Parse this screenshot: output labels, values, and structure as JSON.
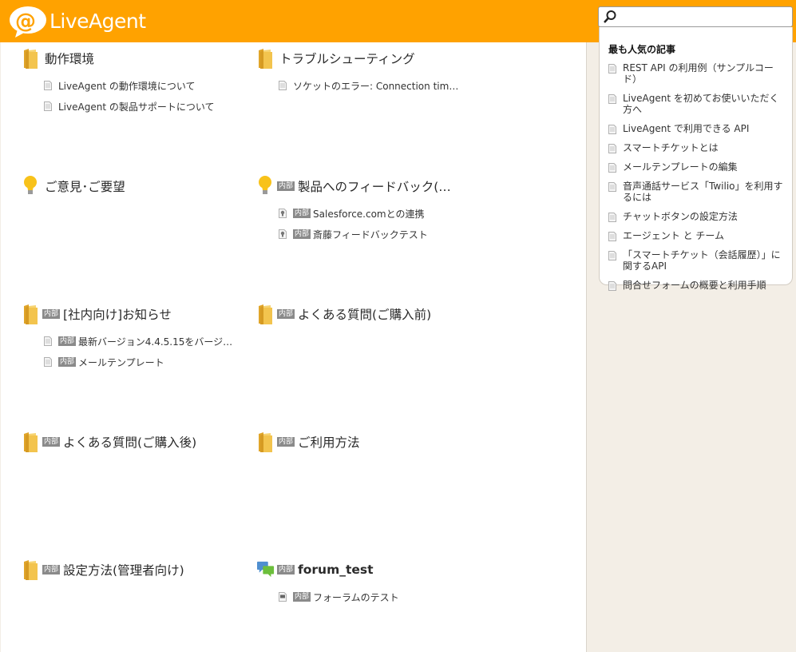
{
  "header": {
    "brand": "LiveAgent",
    "search": {
      "value": "",
      "placeholder": ""
    }
  },
  "badge_label": "内部",
  "categories": [
    {
      "title": "動作環境",
      "icon": "folder-icon",
      "internal": false,
      "bold": false,
      "articles": [
        {
          "text": "LiveAgent の動作環境について",
          "internal": false,
          "icon": "document-icon"
        },
        {
          "text": "LiveAgent の製品サポートについて",
          "internal": false,
          "icon": "document-icon"
        }
      ]
    },
    {
      "title": "トラブルシューティング",
      "icon": "folder-icon",
      "internal": false,
      "bold": false,
      "articles": [
        {
          "text": "ソケットのエラー: Connection timed out",
          "internal": false,
          "icon": "document-icon"
        }
      ]
    },
    {
      "title": "ご意見･ご要望",
      "icon": "lightbulb-icon",
      "internal": false,
      "bold": false,
      "articles": []
    },
    {
      "title": "製品へのフィードバック(…",
      "icon": "lightbulb-icon",
      "internal": true,
      "bold": false,
      "articles": [
        {
          "text": "Salesforce.comとの連携",
          "internal": true,
          "icon": "feedback-icon"
        },
        {
          "text": "斎藤フィードバックテスト",
          "internal": true,
          "icon": "feedback-icon"
        }
      ]
    },
    {
      "title": "[社内向け]お知らせ",
      "icon": "folder-icon",
      "internal": true,
      "bold": false,
      "articles": [
        {
          "text": "最新バージョン4.4.5.15をバージ…",
          "internal": true,
          "icon": "document-icon"
        },
        {
          "text": "メールテンプレート",
          "internal": true,
          "icon": "document-icon"
        }
      ]
    },
    {
      "title": "よくある質問(ご購入前)",
      "icon": "folder-icon",
      "internal": true,
      "bold": false,
      "articles": []
    },
    {
      "title": "よくある質問(ご購入後)",
      "icon": "folder-icon",
      "internal": true,
      "bold": false,
      "articles": []
    },
    {
      "title": "ご利用方法",
      "icon": "folder-icon",
      "internal": true,
      "bold": false,
      "articles": []
    },
    {
      "title": "設定方法(管理者向け)",
      "icon": "folder-icon",
      "internal": true,
      "bold": false,
      "articles": []
    },
    {
      "title": "forum_test",
      "icon": "forum-icon",
      "internal": true,
      "bold": true,
      "articles": [
        {
          "text": "フォーラムのテスト",
          "internal": true,
          "icon": "forum-post-icon"
        }
      ]
    }
  ],
  "sidebar": {
    "title": "最も人気の記事",
    "items": [
      "REST API の利用例（サンプルコード）",
      "LiveAgent を初めてお使いいただく方へ",
      "LiveAgent で利用できる API",
      "スマートチケットとは",
      "メールテンプレートの編集",
      "音声通話サービス「Twilio」を利用するには",
      "チャットボタンの設定方法",
      "エージェント と チーム",
      "「スマートチケット（会話履歴）」に関するAPI",
      "問合せフォームの概要と利用手順"
    ]
  },
  "colors": {
    "header": "#ffa200",
    "background": "#f3eee6",
    "badge": "#8a8a8a"
  }
}
